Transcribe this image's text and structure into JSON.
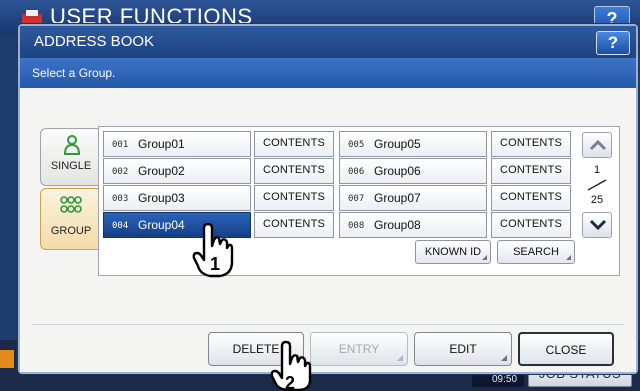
{
  "background": {
    "title": "USER FUNCTIONS",
    "help_label": "?",
    "time_label_top": "",
    "time": "09:50",
    "job_status_label": "JOB STATUS"
  },
  "dialog": {
    "title": "ADDRESS BOOK",
    "help_label": "?",
    "subtitle": "Select a Group."
  },
  "tabs": [
    {
      "label": "SINGLE",
      "icon": "single-person-icon"
    },
    {
      "label": "GROUP",
      "icon": "group-people-icon",
      "active": true
    }
  ],
  "groups": [
    {
      "num": "001",
      "name": "Group01",
      "contents": "CONTENTS"
    },
    {
      "num": "002",
      "name": "Group02",
      "contents": "CONTENTS"
    },
    {
      "num": "003",
      "name": "Group03",
      "contents": "CONTENTS"
    },
    {
      "num": "004",
      "name": "Group04",
      "contents": "CONTENTS",
      "selected": true
    },
    {
      "num": "005",
      "name": "Group05",
      "contents": "CONTENTS"
    },
    {
      "num": "006",
      "name": "Group06",
      "contents": "CONTENTS"
    },
    {
      "num": "007",
      "name": "Group07",
      "contents": "CONTENTS"
    },
    {
      "num": "008",
      "name": "Group08",
      "contents": "CONTENTS"
    }
  ],
  "pager": {
    "current": "1",
    "total": "25"
  },
  "list_buttons": {
    "known_id": "KNOWN ID",
    "search": "SEARCH"
  },
  "actions": {
    "delete": "DELETE",
    "entry": "ENTRY",
    "edit": "EDIT",
    "close": "CLOSE"
  },
  "step_markers": {
    "first": "1",
    "second": "2"
  },
  "colors": {
    "title_bar": "#2f5aa0",
    "selected_row": "#1d4a96",
    "group_tab": "#f2dca8",
    "accent_orange": "#e58a1f"
  }
}
